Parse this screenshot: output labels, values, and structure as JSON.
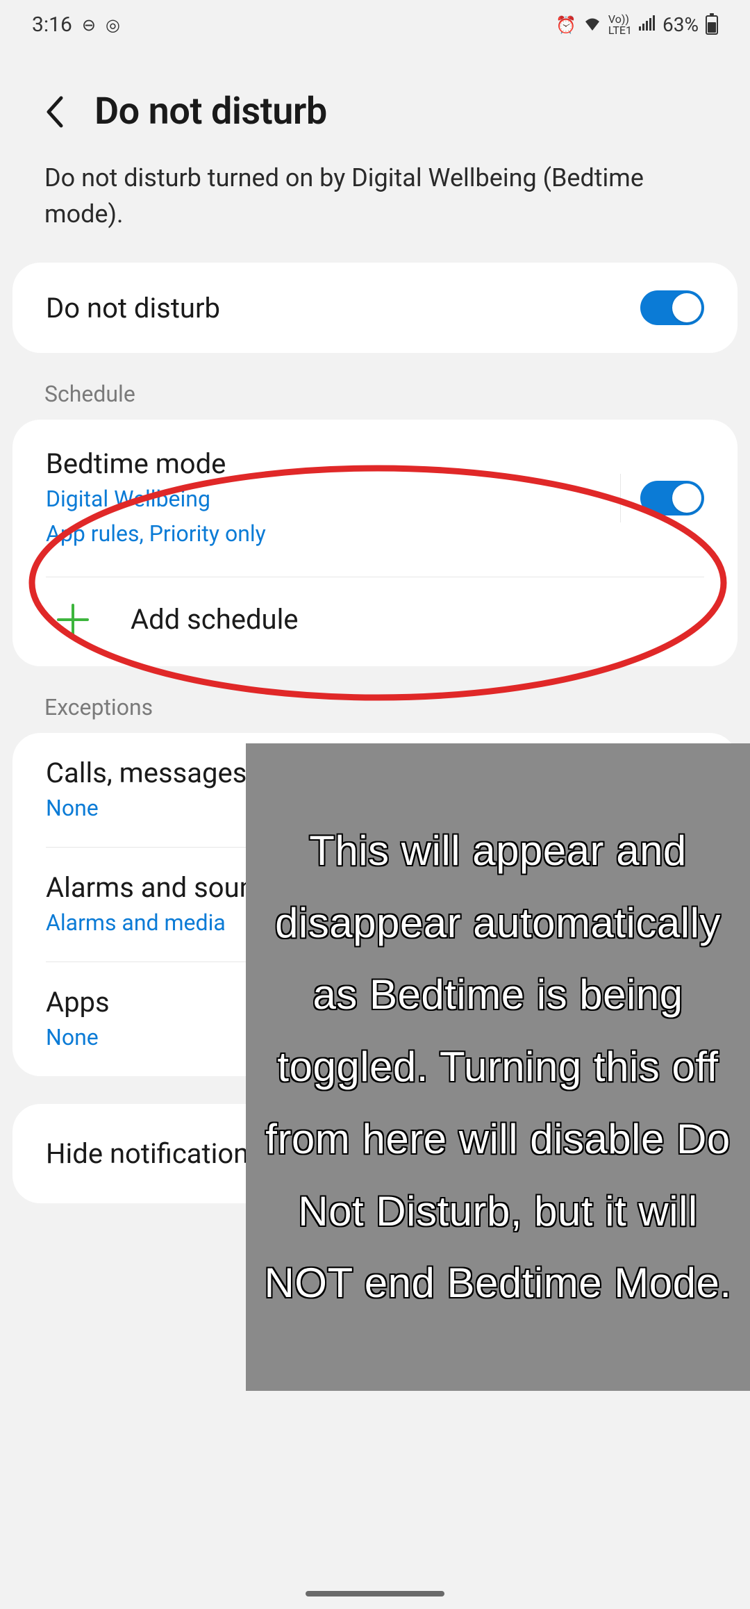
{
  "status_bar": {
    "time": "3:16",
    "battery_pct": "63%",
    "network_label": "LTE1",
    "volte_label": "Vo))"
  },
  "header": {
    "title": "Do not disturb",
    "subtitle": "Do not disturb turned on by Digital Wellbeing (Bedtime mode)."
  },
  "dnd_card": {
    "label": "Do not disturb"
  },
  "schedule": {
    "section": "Schedule",
    "bedtime": {
      "title": "Bedtime mode",
      "sub1": "Digital Wellbeing",
      "sub2": "App rules, Priority only"
    },
    "add_label": "Add schedule"
  },
  "exceptions": {
    "section": "Exceptions",
    "calls": {
      "title": "Calls, messages, and conversations",
      "sub": "None"
    },
    "alarms": {
      "title": "Alarms and sounds",
      "sub": "Alarms and media"
    },
    "apps": {
      "title": "Apps",
      "sub": "None"
    }
  },
  "hide_card": {
    "title": "Hide notifications"
  },
  "annotation": {
    "text": "This will appear and disappear automatically as Bedtime is being toggled. Turning this off from here will disable Do Not Disturb, but it will NOT end Bedtime Mode."
  }
}
